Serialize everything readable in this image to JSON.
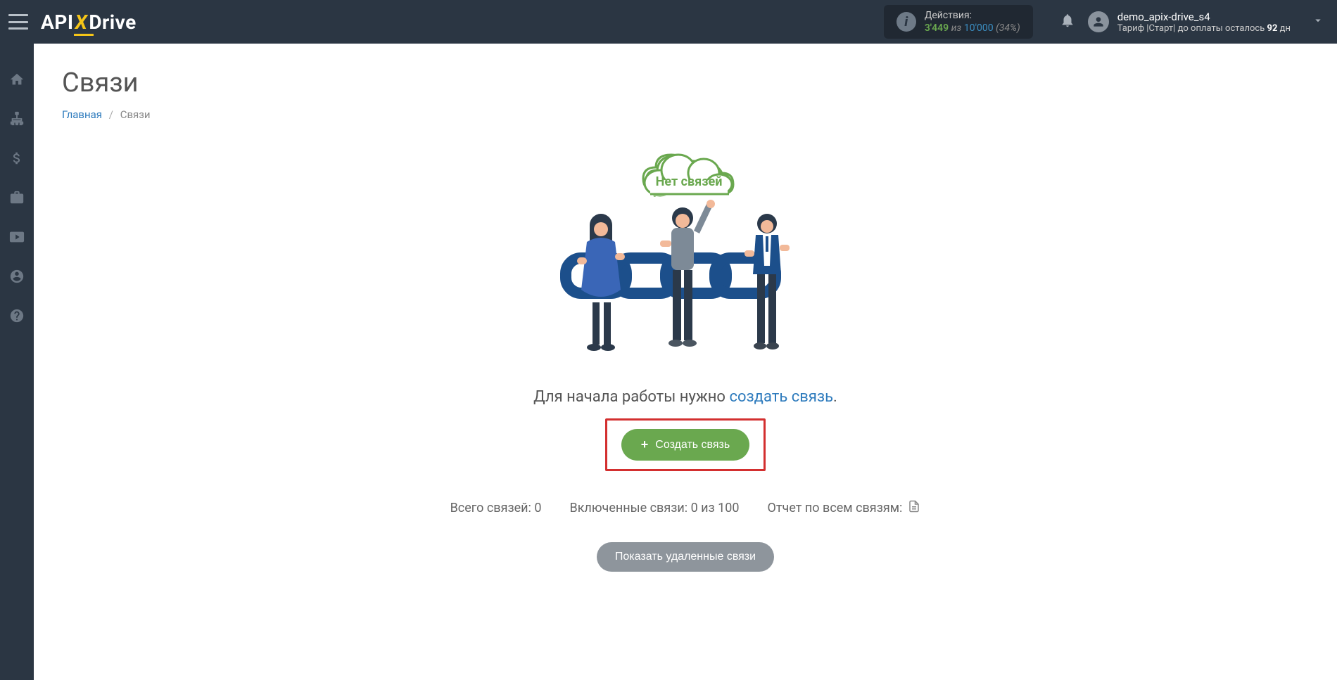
{
  "header": {
    "logo_api": "API",
    "logo_x": "X",
    "logo_drive": "Drive",
    "actions": {
      "label": "Действия:",
      "current": "3'449",
      "separator": "из",
      "limit": "10'000",
      "percent": "(34%)"
    },
    "user": {
      "username": "demo_apix-drive_s4",
      "tariff_prefix": "Тариф |Старт| до оплаты осталось ",
      "tariff_days": "92",
      "tariff_suffix": " дн"
    }
  },
  "page": {
    "title": "Связи",
    "breadcrumb_home": "Главная",
    "breadcrumb_current": "Связи"
  },
  "illustration": {
    "cloud_text": "Нет связей"
  },
  "onboard": {
    "text_prefix": "Для начала работы нужно ",
    "link_text": "создать связь",
    "text_suffix": "."
  },
  "buttons": {
    "create": "Создать связь",
    "show_deleted": "Показать удаленные связи"
  },
  "stats": {
    "total_label": "Всего связей: ",
    "total_value": "0",
    "enabled_label": "Включенные связи: ",
    "enabled_value": "0 из 100",
    "report_label": "Отчет по всем связям:"
  }
}
